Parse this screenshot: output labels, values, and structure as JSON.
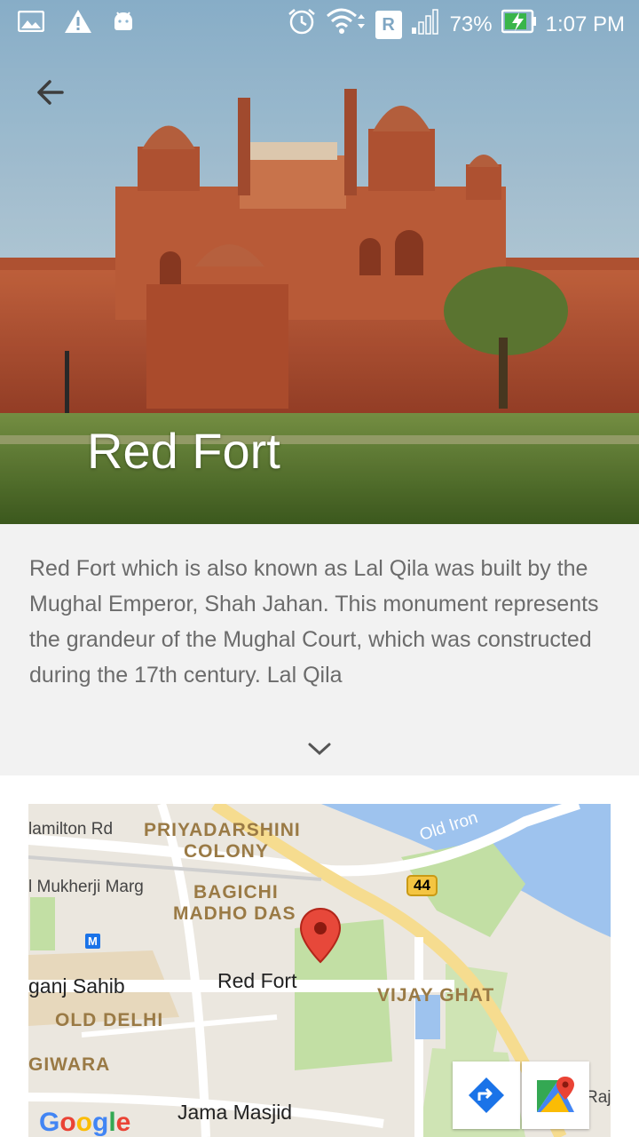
{
  "status_bar": {
    "battery": "73%",
    "time": "1:07 PM",
    "network_badge": "R",
    "icons": [
      "image-icon",
      "warning-icon",
      "android-icon",
      "alarm-icon",
      "wifi-icon",
      "signal-icon",
      "battery-icon"
    ]
  },
  "hero": {
    "title": "Red Fort"
  },
  "description": {
    "text": "Red Fort which is also known as Lal Qila was built by the Mughal Emperor, Shah Jahan. This monument represents the grandeur of the Mughal Court, which was constructed during the 17th century. Lal Qila"
  },
  "map": {
    "labels": {
      "hamilton": "lamilton Rd",
      "priyadarshini": "PRIYADARSHINI",
      "colony": "COLONY",
      "mukherji": "l Mukherji Marg",
      "bagichi": "BAGICHI",
      "madho": "MADHO DAS",
      "old_iron": "Old Iron",
      "route": "44",
      "ganj": "ganj Sahib",
      "red_fort": "Red Fort",
      "vijay": "VIJAY GHAT",
      "old_delhi": "OLD DELHI",
      "giwara": "GIWARA",
      "jama": "Jama Masjid",
      "raja": "Raja",
      "metro": "M"
    },
    "google": [
      "G",
      "o",
      "o",
      "g",
      "l",
      "e"
    ],
    "colors": {
      "google": [
        "#4285F4",
        "#EA4335",
        "#FBBC05",
        "#4285F4",
        "#34A853",
        "#EA4335"
      ]
    }
  }
}
